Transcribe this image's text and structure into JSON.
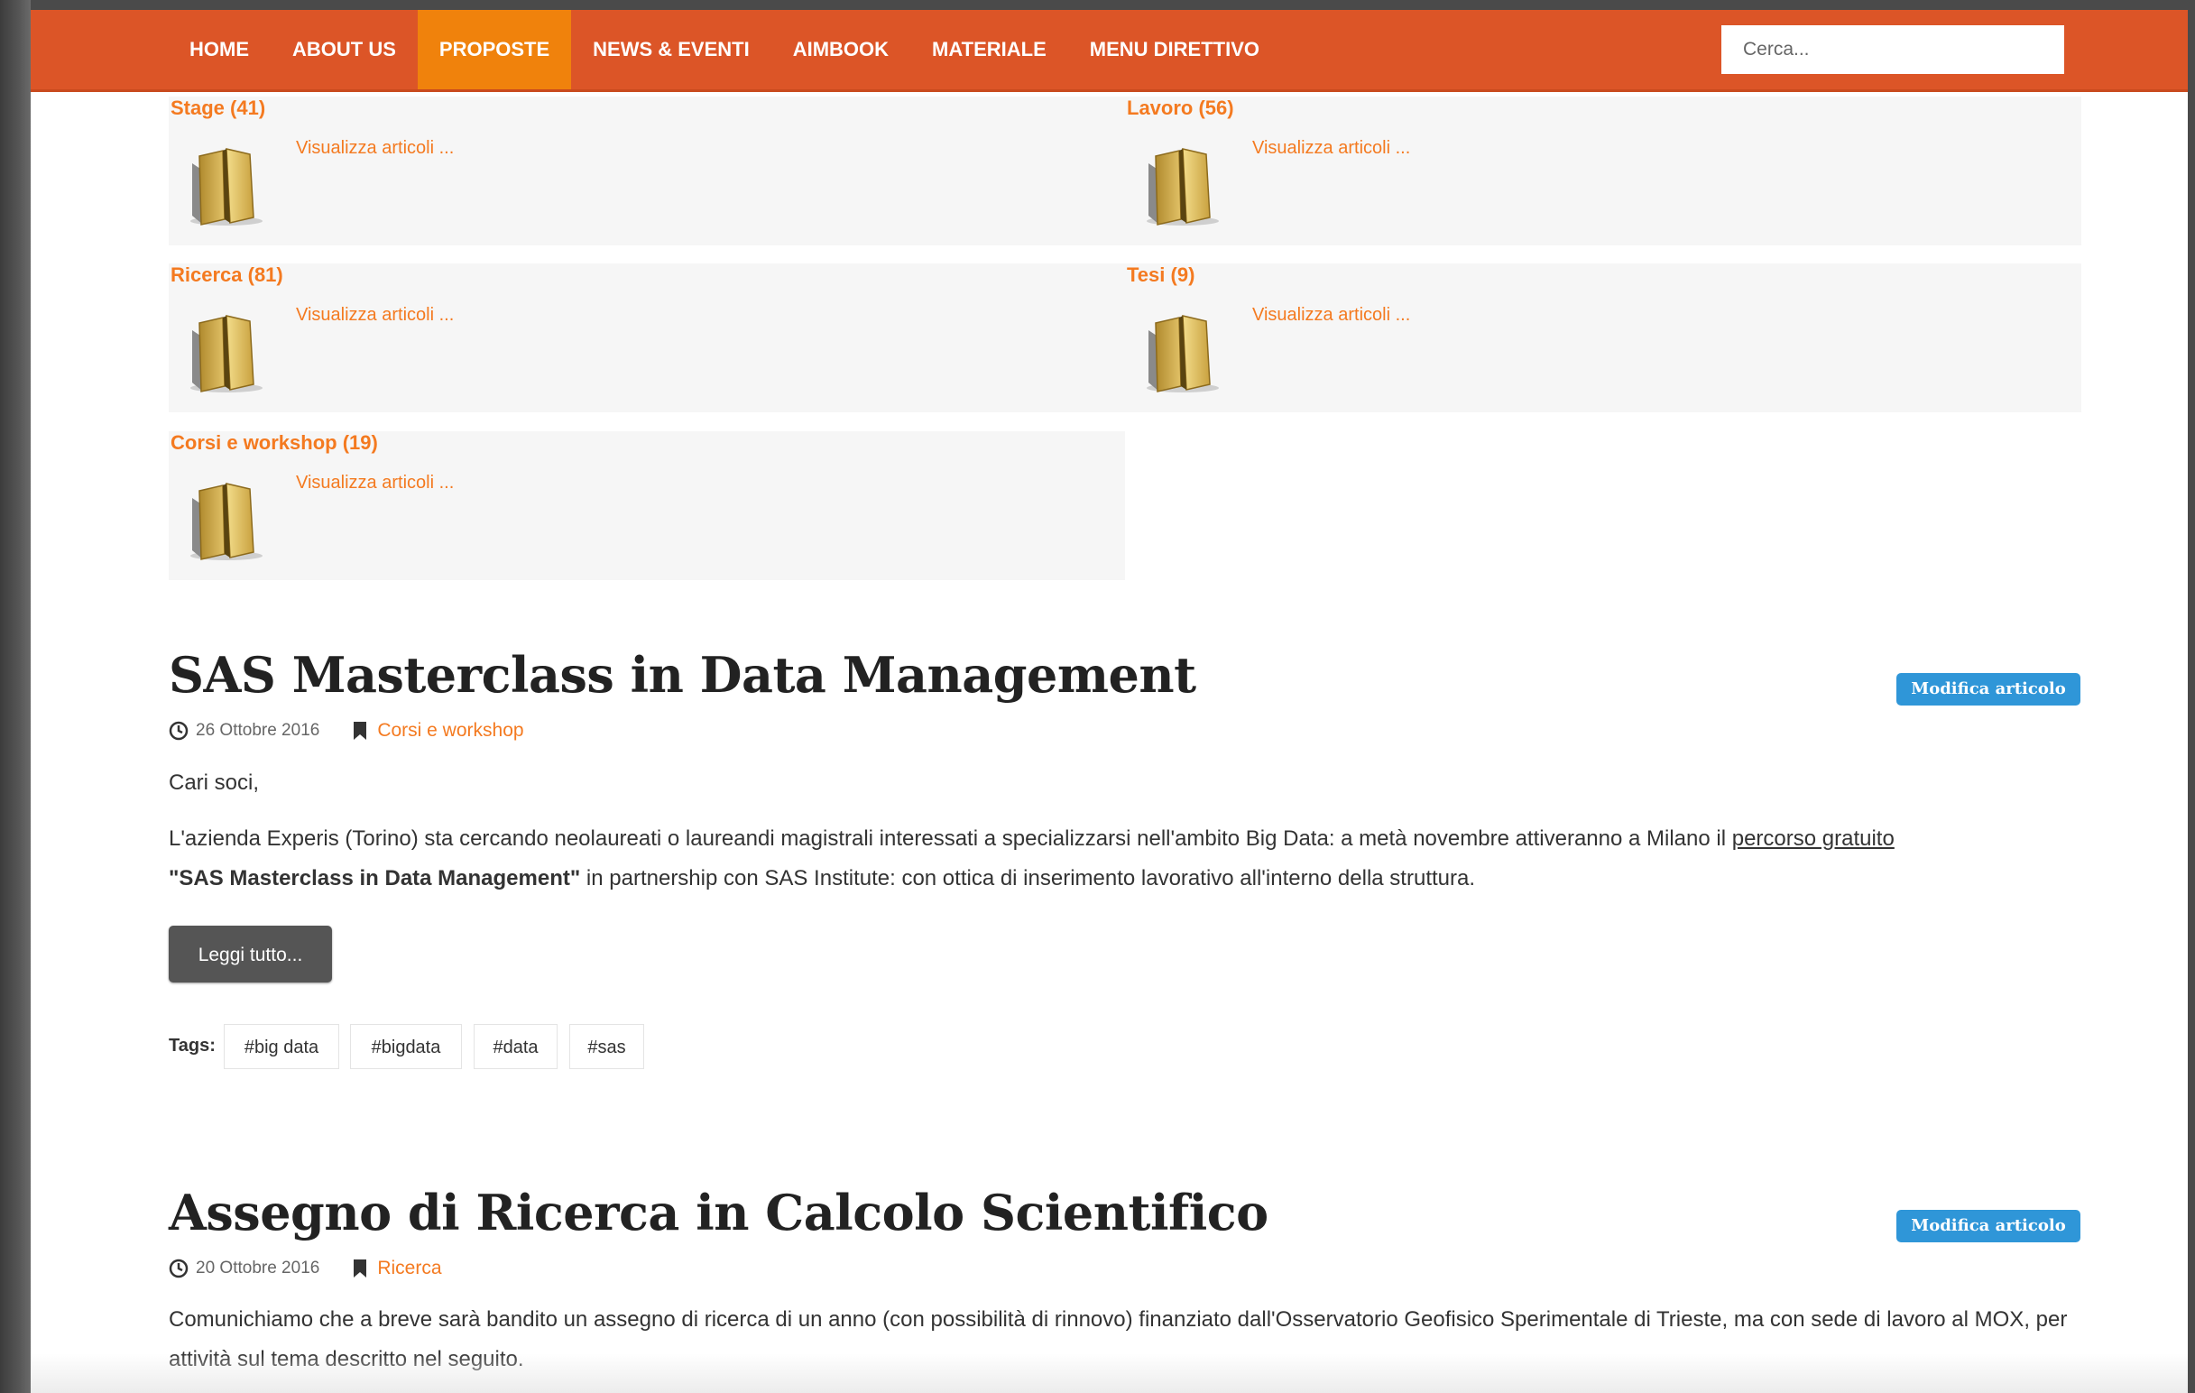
{
  "nav": {
    "items": [
      {
        "label": "HOME"
      },
      {
        "label": "ABOUT US"
      },
      {
        "label": "PROPOSTE"
      },
      {
        "label": "NEWS & EVENTI"
      },
      {
        "label": "AIMBOOK"
      },
      {
        "label": "MATERIALE"
      },
      {
        "label": "MENU DIRETTIVO"
      }
    ],
    "active": "PROPOSTE",
    "search_placeholder": "Cerca..."
  },
  "categories": [
    {
      "title": "Stage (41)",
      "link": "Visualizza articoli ..."
    },
    {
      "title": "Lavoro (56)",
      "link": "Visualizza articoli ..."
    },
    {
      "title": "Ricerca (81)",
      "link": "Visualizza articoli ..."
    },
    {
      "title": "Tesi (9)",
      "link": "Visualizza articoli ..."
    },
    {
      "title": "Corsi e workshop (19)",
      "link": "Visualizza articoli ..."
    }
  ],
  "articles": [
    {
      "title": "SAS Masterclass in Data Management",
      "edit_label": "Modifica articolo",
      "date": "26 Ottobre 2016",
      "category": "Corsi e workshop",
      "greeting": "Cari soci,",
      "body_part1": "L'azienda Experis (Torino) sta cercando neolaureati o laureandi magistrali interessati a specializzarsi nell'ambito Big Data: a metà novembre attiveranno a Milano il ",
      "body_link": "percorso gratuito",
      "body_bold": "\"SAS Masterclass in Data Management\"",
      "body_part2": " in partnership con SAS Institute: con ottica di inserimento lavorativo all'interno della struttura.",
      "read_more": "Leggi tutto...",
      "tags_label": "Tags:",
      "tags": [
        "#big data",
        "#bigdata",
        "#data",
        "#sas"
      ]
    },
    {
      "title": "Assegno di Ricerca in Calcolo Scientifico",
      "edit_label": "Modifica articolo",
      "date": "20 Ottobre 2016",
      "category": "Ricerca",
      "body": "Comunichiamo che a breve sarà bandito un assegno di ricerca di un anno (con possibilità di rinnovo) finanziato dall'Osservatorio Geofisico Sperimentale di Trieste, ma con sede di lavoro al MOX, per attività sul tema descritto nel seguito."
    }
  ],
  "icons": {
    "folder": "folder-icon",
    "clock": "clock-icon",
    "bookmark": "bookmark-icon"
  },
  "colors": {
    "navbar": "#dc5527",
    "nav_active": "#f0820c",
    "accent_link": "#f47a20",
    "edit_badge": "#2f96d8",
    "read_more_button": "#555555"
  }
}
